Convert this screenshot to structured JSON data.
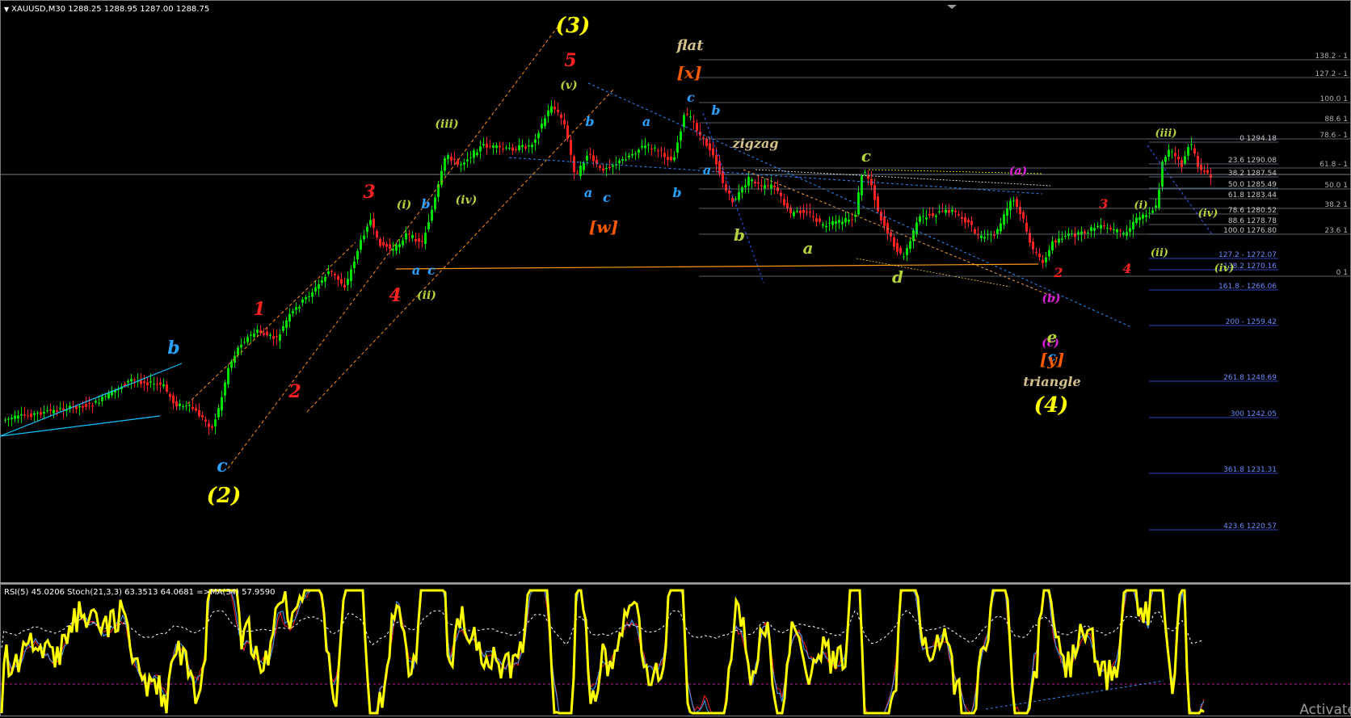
{
  "header": {
    "symbol_info": "XAUUSD,M30  1288.25 1288.95 1287.00 1288.75",
    "indicator_info": "RSI(5) 45.0206  Stoch(21,3,3) 63.3513 64.0681  =>MA(34) 57.9590"
  },
  "watermark": "Activate",
  "colors": {
    "background": "#000000",
    "bull_candle": "#00e000",
    "bear_candle": "#ff2020",
    "wave_red": "#ff2020",
    "wave_yellow": "#ffff00",
    "wave_blue": "#2aa0ff",
    "wave_green": "#b4d23c",
    "wave_orange": "#ff5a00",
    "wave_magenta": "#e020e0",
    "wave_tan": "#d4c08a",
    "fib_line_grey": "#708090",
    "fib_line_blue": "#3a5cff",
    "rsi_line": "#ffff00",
    "stoch_main": "#3aa0ff",
    "stoch_signal": "#ff2020"
  },
  "wave_labels": [
    {
      "text": "(3)",
      "color": "wave_yellow",
      "size": 26
    },
    {
      "text": "5",
      "color": "wave_red",
      "size": 22
    },
    {
      "text": "(v)",
      "color": "wave_green",
      "size": 14
    },
    {
      "text": "(iii)",
      "color": "wave_green",
      "size": 14
    },
    {
      "text": "3",
      "color": "wave_red",
      "size": 22
    },
    {
      "text": "(i)",
      "color": "wave_green",
      "size": 14
    },
    {
      "text": "b",
      "color": "wave_blue",
      "size": 16
    },
    {
      "text": "(iv)",
      "color": "wave_green",
      "size": 14
    },
    {
      "text": "a",
      "color": "wave_blue",
      "size": 16
    },
    {
      "text": "c",
      "color": "wave_blue",
      "size": 16
    },
    {
      "text": "(ii)",
      "color": "wave_green",
      "size": 14
    },
    {
      "text": "4",
      "color": "wave_red",
      "size": 22
    },
    {
      "text": "1",
      "color": "wave_red",
      "size": 22
    },
    {
      "text": "2",
      "color": "wave_red",
      "size": 22
    },
    {
      "text": "b",
      "color": "wave_blue",
      "size": 22
    },
    {
      "text": "c",
      "color": "wave_blue",
      "size": 22
    },
    {
      "text": "(2)",
      "color": "wave_yellow",
      "size": 26
    },
    {
      "text": "flat",
      "color": "wave_tan",
      "size": 18
    },
    {
      "text": "[x]",
      "color": "wave_orange",
      "size": 20
    },
    {
      "text": "c",
      "color": "wave_blue",
      "size": 16
    },
    {
      "text": "b",
      "color": "wave_blue",
      "size": 16
    },
    {
      "text": "b",
      "color": "wave_blue",
      "size": 16
    },
    {
      "text": "a",
      "color": "wave_blue",
      "size": 16
    },
    {
      "text": "a",
      "color": "wave_blue",
      "size": 16
    },
    {
      "text": "c",
      "color": "wave_blue",
      "size": 16
    },
    {
      "text": "b",
      "color": "wave_blue",
      "size": 16
    },
    {
      "text": "a",
      "color": "wave_blue",
      "size": 16
    },
    {
      "text": "[w]",
      "color": "wave_orange",
      "size": 20
    },
    {
      "text": "zigzag",
      "color": "wave_tan",
      "size": 16
    },
    {
      "text": "b",
      "color": "wave_green",
      "size": 20
    },
    {
      "text": "a",
      "color": "wave_green",
      "size": 20
    },
    {
      "text": "c",
      "color": "wave_green",
      "size": 20
    },
    {
      "text": "d",
      "color": "wave_green",
      "size": 20
    },
    {
      "text": "(a)",
      "color": "wave_magenta",
      "size": 14
    },
    {
      "text": "(b)",
      "color": "wave_magenta",
      "size": 14
    },
    {
      "text": "(c)",
      "color": "wave_magenta",
      "size": 14
    },
    {
      "text": "e",
      "color": "wave_green",
      "size": 20
    },
    {
      "text": "c",
      "color": "wave_blue",
      "size": 16
    },
    {
      "text": "[y]",
      "color": "wave_orange",
      "size": 20
    },
    {
      "text": "triangle",
      "color": "wave_tan",
      "size": 16
    },
    {
      "text": "(4)",
      "color": "wave_yellow",
      "size": 26
    },
    {
      "text": "2",
      "color": "wave_red",
      "size": 16
    },
    {
      "text": "3",
      "color": "wave_red",
      "size": 16
    },
    {
      "text": "4",
      "color": "wave_red",
      "size": 16
    },
    {
      "text": "(i)",
      "color": "wave_green",
      "size": 13
    },
    {
      "text": "(ii)",
      "color": "wave_green",
      "size": 13
    },
    {
      "text": "(iii)",
      "color": "wave_green",
      "size": 13
    },
    {
      "text": "(iv)",
      "color": "wave_green",
      "size": 13
    },
    {
      "text": "(iv)",
      "color": "wave_green",
      "size": 13
    }
  ],
  "fib_retracement_upper": [
    {
      "text": "138.2 - 1"
    },
    {
      "text": "127.2 - 1"
    },
    {
      "text": "100.0 1"
    },
    {
      "text": "88.6 1"
    },
    {
      "text": "78.6 - 1"
    },
    {
      "text": "61.8 - 1"
    },
    {
      "text": "50.0 1"
    },
    {
      "text": "38.2 1"
    },
    {
      "text": "23.6 1"
    },
    {
      "text": "0 1"
    }
  ],
  "fib_extension": [
    {
      "text": "0 1294.18"
    },
    {
      "text": "23.6 1290.08"
    },
    {
      "text": "38.2 1287.54"
    },
    {
      "text": "50.0 1285.49"
    },
    {
      "text": "61.8 1283.44"
    },
    {
      "text": "78.6 1280.52"
    },
    {
      "text": "88.6 1278.78"
    },
    {
      "text": "100.0 1276.80"
    },
    {
      "text": "127.2 - 1272.07"
    },
    {
      "text": "138.2 1270.16"
    },
    {
      "text": "161.8 - 1266.06"
    },
    {
      "text": "200 - 1259.42"
    },
    {
      "text": "261.8 1248.69"
    },
    {
      "text": "300 1242.05"
    },
    {
      "text": "361.8 1231.31"
    },
    {
      "text": "423.6 1220.57"
    }
  ]
}
